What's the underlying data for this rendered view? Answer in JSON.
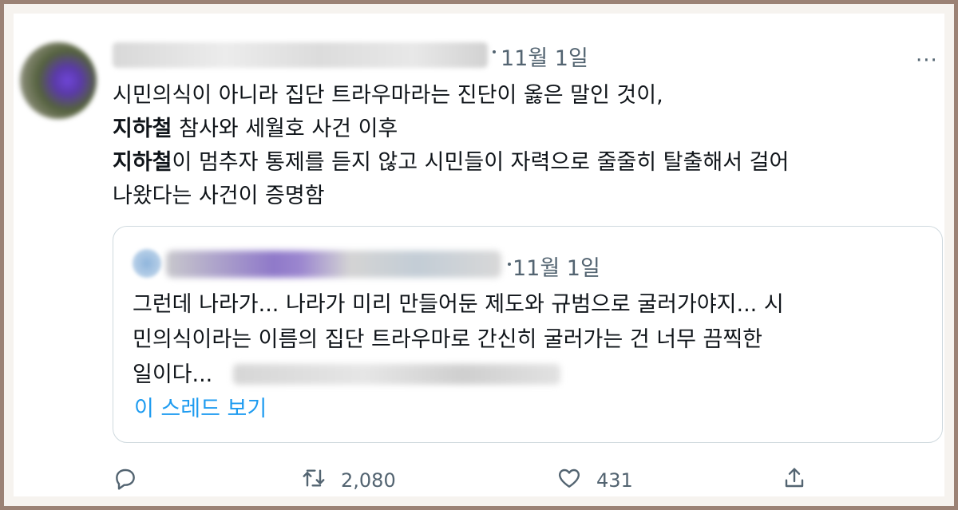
{
  "tweet": {
    "date": "11월 1일",
    "more_label": "···",
    "lines": [
      [
        {
          "text": "시민의식이 아니라 집단 트라우마라는 진단이 옳은 말인 것이,",
          "bold": false
        }
      ],
      [
        {
          "text": "지하철",
          "bold": true
        },
        {
          "text": " 참사와 세월호 사건 이후",
          "bold": false
        }
      ],
      [
        {
          "text": "지하철",
          "bold": true
        },
        {
          "text": "이 멈추자 통제를 듣지 않고 시민들이 자력으로 줄줄히 탈출해서 걸어",
          "bold": false
        }
      ],
      [
        {
          "text": "나왔다는 사건이 증명함",
          "bold": false
        }
      ]
    ]
  },
  "quote": {
    "date": "11월 1일",
    "lines": [
      "그런데 나라가... 나라가 미리 만들어둔 제도와 규범으로 굴러가야지... 시",
      "민의식이라는 이름의 집단 트라우마로 간신히 굴러가는 건 너무 끔찍한",
      "일이다..."
    ],
    "thread_link": "이 스레드 보기"
  },
  "actions": {
    "reply_icon": "reply-icon",
    "retweet_icon": "retweet-icon",
    "retweet_count": "2,080",
    "like_icon": "heart-icon",
    "like_count": "431",
    "share_icon": "share-icon"
  },
  "colors": {
    "text": "#0f1419",
    "secondary": "#536471",
    "link": "#1d9bf0",
    "border": "#cfd9de",
    "frame": "#9b8275"
  }
}
